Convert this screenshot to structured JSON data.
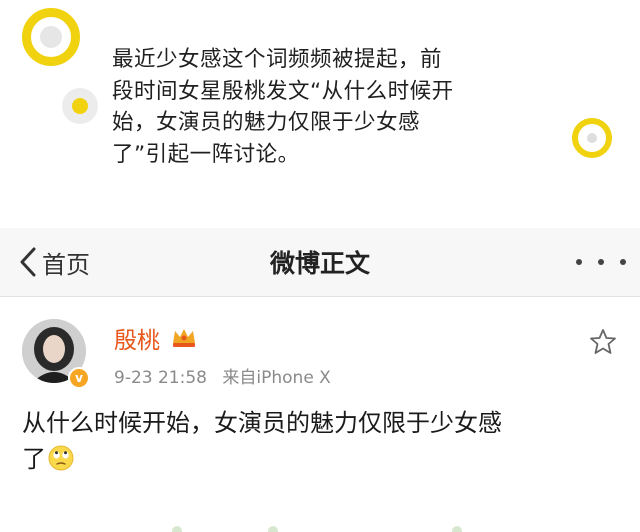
{
  "caption": {
    "lines": [
      "最近少女感这个词频频被提起，前",
      "段时间女星殷桃发文“从什么时候开",
      "始，女演员的魅力仅限于少女感",
      "了”引起一阵讨论。"
    ]
  },
  "navbar": {
    "back_label": "首页",
    "title": "微博正文",
    "more_icon": "more-icon"
  },
  "post": {
    "username": "殷桃",
    "date": "9-23 21:58",
    "source": "来自iPhone X",
    "text_lines": [
      "从什么时候开始，女演员的魅力仅限于少女感",
      "了"
    ],
    "verified": true
  },
  "colors": {
    "accent_yellow": "#f1d20f",
    "username_orange": "#e8571c",
    "meta_gray": "#8a8a8a",
    "navbar_bg": "#f7f7f7"
  }
}
